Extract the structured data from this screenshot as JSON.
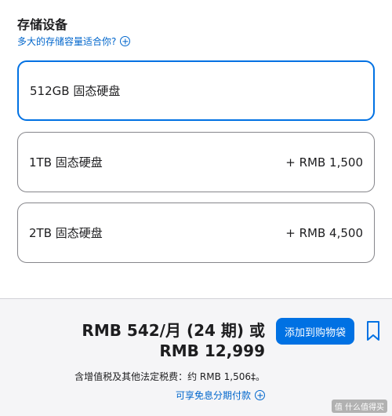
{
  "section": {
    "title": "存储设备",
    "help_link": "多大的存储容量适合你?"
  },
  "options": [
    {
      "name": "512GB 固态硬盘",
      "price": "",
      "selected": true
    },
    {
      "name": "1TB 固态硬盘",
      "price": "+ RMB 1,500",
      "selected": false
    },
    {
      "name": "2TB 固态硬盘",
      "price": "+ RMB 4,500",
      "selected": false
    }
  ],
  "footer": {
    "monthly": "RMB 542/月 (24 期) 或",
    "total": "RMB 12,999",
    "tax_note": "含增值税及其他法定税费：约 RMB 1,506‡。",
    "installment_link": "可享免息分期付款",
    "add_to_bag": "添加到购物袋"
  },
  "colors": {
    "accent": "#0071e3",
    "link": "#0066cc",
    "footer_bg": "#f5f5f7"
  },
  "icons": [
    "plus-circle-icon",
    "bookmark-icon"
  ],
  "watermark": "值 什么值得买"
}
